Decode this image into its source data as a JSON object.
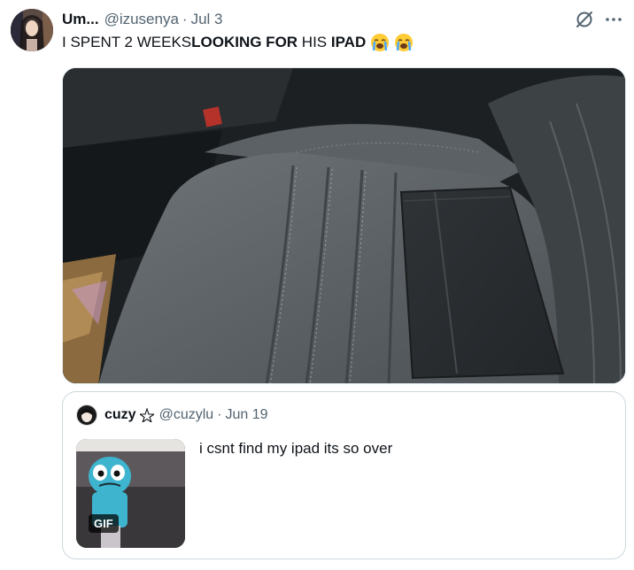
{
  "tweet": {
    "display_name": "Um...",
    "handle": "@izusenya",
    "separator": "·",
    "date": "Jul 3",
    "text_parts": [
      "I SPENT 2 WEEKS ",
      "LOOKING FOR",
      " HIS ",
      "IPAD"
    ],
    "emojis": [
      "loudly-crying-face",
      "loudly-crying-face"
    ]
  },
  "media": {
    "icon": "photo-car-seat-with-ipad"
  },
  "quote": {
    "display_name": "cuzy",
    "badge": "pentagram-icon",
    "handle": "@cuzylu",
    "separator": "·",
    "date": "Jun 19",
    "text": "i csnt find my ipad its so over",
    "gif_label": "GIF"
  }
}
